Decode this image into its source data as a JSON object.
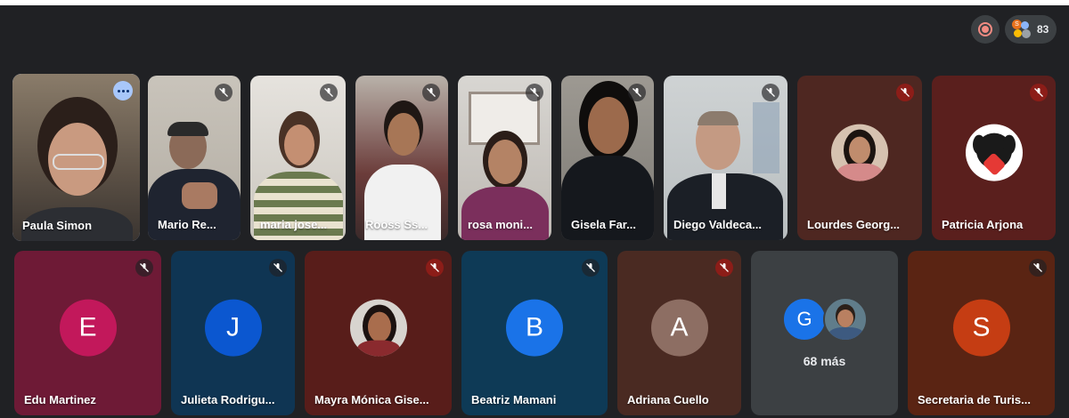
{
  "header": {
    "participant_count": "83"
  },
  "row1": [
    {
      "name": "Paula Simon"
    },
    {
      "name": "Mario Re..."
    },
    {
      "name": "maria jose..."
    },
    {
      "name": "Rooss Ss..."
    },
    {
      "name": "rosa moni..."
    },
    {
      "name": "Gisela Far..."
    },
    {
      "name": "Diego Valdeca..."
    },
    {
      "name": "Lourdes Georg..."
    },
    {
      "name": "Patricia Arjona"
    }
  ],
  "row2": [
    {
      "name": "Edu Martinez",
      "initial": "E",
      "color": "#c2185b"
    },
    {
      "name": "Julieta Rodrigu...",
      "initial": "J",
      "color": "#0b57d0"
    },
    {
      "name": "Mayra Mónica Gise..."
    },
    {
      "name": "Beatriz Mamani",
      "initial": "B",
      "color": "#1a73e8"
    },
    {
      "name": "Adriana Cuello",
      "initial": "A",
      "color": "#8d6e63"
    },
    {
      "more_label": "68 más",
      "initial": "G"
    },
    {
      "name": "Secretaria de Turis...",
      "initial": "S",
      "color": "#c53d13"
    }
  ],
  "colors": {
    "background": "#202124",
    "accent": "#a8c7fa",
    "mute_red": "#8c1d18"
  },
  "icons": {
    "record": "record-icon",
    "mute": "mic-off-icon",
    "more": "more-options-icon"
  }
}
